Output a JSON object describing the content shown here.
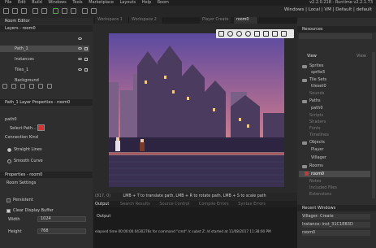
{
  "menubar": {
    "items": [
      "File",
      "Edit",
      "Build",
      "Windows",
      "Tools",
      "Marketplace",
      "Layouts",
      "Help",
      "Room"
    ],
    "version": "v2.2.0.218 - Runtime v2.2.1.73"
  },
  "toolbar": {
    "windows_dropdown": "Windows | Local | VM | Default | default"
  },
  "tabs": [
    {
      "label": "Workspace 1",
      "active": false
    },
    {
      "label": "Workspace 2",
      "active": false
    },
    {
      "label": "Player Create",
      "active": false
    },
    {
      "label": "room0",
      "active": true
    }
  ],
  "left": {
    "title": "Room Editor",
    "layers_header": "Layers - room0",
    "layers": [
      {
        "name": "Path_1",
        "selected": true
      },
      {
        "name": "Instances",
        "selected": false
      },
      {
        "name": "Tiles_1",
        "selected": false
      },
      {
        "name": "Background",
        "selected": false
      }
    ],
    "path_props_header": "Path_1 Layer Properties - room0",
    "path_name": "path0",
    "select_path_label": "Select Path...",
    "connection_kind_label": "Connection Kind",
    "straight_lines_label": "Straight Lines",
    "smooth_curve_label": "Smooth Curve",
    "properties_header": "Properties - room0",
    "room_settings_label": "Room Settings",
    "persistent_label": "Persistent",
    "clear_display_label": "Clear Display Buffer",
    "width_label": "Width",
    "width_value": "1024",
    "height_label": "Height",
    "height_value": "768"
  },
  "viewport": {
    "status": "LMB + T to translate path, LMB + R to rotate path, LMB + S to scale path",
    "status_left": "(817, 0)"
  },
  "output": {
    "tabs": [
      "Output",
      "Search Results",
      "Source Control",
      "Compile Errors",
      "Syntax Errors"
    ],
    "title": "Output",
    "line": "elapsed time 00:00:00.0430276s for command \"cmd\" /c subst Z: /d started at 11/08/2017 11:38:00 PM"
  },
  "right": {
    "resources_header": "Resources",
    "view_label": "View",
    "view_right": "View",
    "items": [
      {
        "label": "Sprites",
        "dim": false
      },
      {
        "label": "sprite5",
        "dim": false
      },
      {
        "label": "Tile Sets",
        "dim": false
      },
      {
        "label": "tileset0",
        "dim": false
      },
      {
        "label": "Sounds",
        "dim": true
      },
      {
        "label": "Paths",
        "dim": false
      },
      {
        "label": "path0",
        "dim": false
      },
      {
        "label": "Scripts",
        "dim": true
      },
      {
        "label": "Shaders",
        "dim": true
      },
      {
        "label": "Fonts",
        "dim": true
      },
      {
        "label": "Timelines",
        "dim": true
      },
      {
        "label": "Objects",
        "dim": false
      },
      {
        "label": "Player",
        "dim": false
      },
      {
        "label": "Villager",
        "dim": false
      },
      {
        "label": "Rooms",
        "dim": false
      },
      {
        "label": "room0",
        "dim": false
      },
      {
        "label": "Notes",
        "dim": true
      },
      {
        "label": "Included Files",
        "dim": true
      },
      {
        "label": "Extensions",
        "dim": true
      }
    ],
    "recent_header": "Recent Windows",
    "recent": [
      "Villager: Create",
      "Instance: inst_31C1EB3D",
      "room0"
    ]
  },
  "colors": {
    "sky_top": "#5b4aa0",
    "sky_bottom": "#e9a48c",
    "path_swatch": "#d83232",
    "selected": "#4a4a4a"
  }
}
